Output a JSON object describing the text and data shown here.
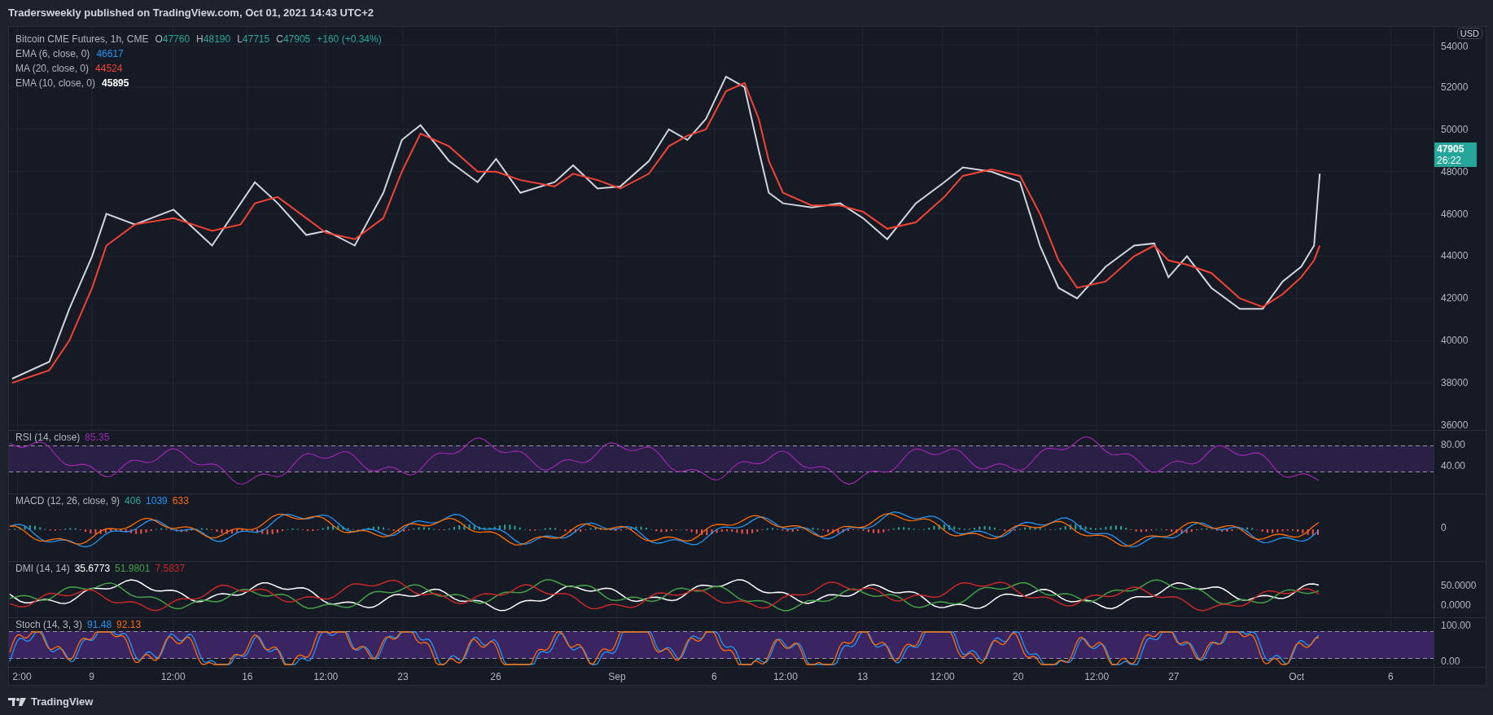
{
  "header": {
    "title": "Tradersweekly published on TradingView.com, Oct 01, 2021 14:43 UTC+2"
  },
  "main_chart": {
    "legend": {
      "symbol": "Bitcoin CME Futures, 1h, CME",
      "ohlc": [
        {
          "key": "O",
          "value": "47760"
        },
        {
          "key": "H",
          "value": "48190"
        },
        {
          "key": "L",
          "value": "47715"
        },
        {
          "key": "C",
          "value": "47905"
        }
      ],
      "change": "+160 (+0.34%)"
    },
    "indicators": [
      {
        "label": "EMA (6, close, 0)",
        "value": "46617",
        "color": "#2196f3"
      },
      {
        "label": "MA (20, close, 0)",
        "value": "44524",
        "color": "#f44336"
      },
      {
        "label": "EMA (10, close, 0)",
        "value": "45895",
        "color": "#ffffff"
      }
    ],
    "currency": "USD",
    "last_price": {
      "price": "47905",
      "countdown": "26:22"
    },
    "price_axis": [
      "54000",
      "52000",
      "50000",
      "48000",
      "46000",
      "44000",
      "42000",
      "40000",
      "38000",
      "36000"
    ]
  },
  "panes": [
    {
      "kind": "rsi",
      "label": "RSI (14, close)",
      "values": [
        {
          "text": "85.35",
          "color": "#9c27b0"
        }
      ],
      "axis_labels": [
        "80.00",
        "40.00"
      ]
    },
    {
      "kind": "macd",
      "label": "MACD (12, 26, close, 9)",
      "values": [
        {
          "text": "406",
          "color": "#26a69a"
        },
        {
          "text": "1039",
          "color": "#2196f3"
        },
        {
          "text": "633",
          "color": "#ff6d00"
        }
      ],
      "axis_labels": [
        "0"
      ]
    },
    {
      "kind": "dmi",
      "label": "DMI (14, 14)",
      "values": [
        {
          "text": "35.6773",
          "color": "#ffffff"
        },
        {
          "text": "51.9801",
          "color": "#43a047"
        },
        {
          "text": "7.5837",
          "color": "#c62828"
        }
      ],
      "axis_labels": [
        "50.0000",
        "0.0000"
      ]
    },
    {
      "kind": "stoch",
      "label": "Stoch (14, 3, 3)",
      "values": [
        {
          "text": "91.48",
          "color": "#2196f3"
        },
        {
          "text": "92.13",
          "color": "#ff6d00"
        }
      ],
      "axis_labels": [
        "100.00",
        "0.00"
      ]
    }
  ],
  "time_axis": [
    "2:00",
    "9",
    "12:00",
    "16",
    "12:00",
    "23",
    "26",
    "Sep",
    "6",
    "12:00",
    "13",
    "12:00",
    "20",
    "12:00",
    "27",
    "Oct",
    "6"
  ],
  "footer": {
    "brand": "TradingView"
  }
}
